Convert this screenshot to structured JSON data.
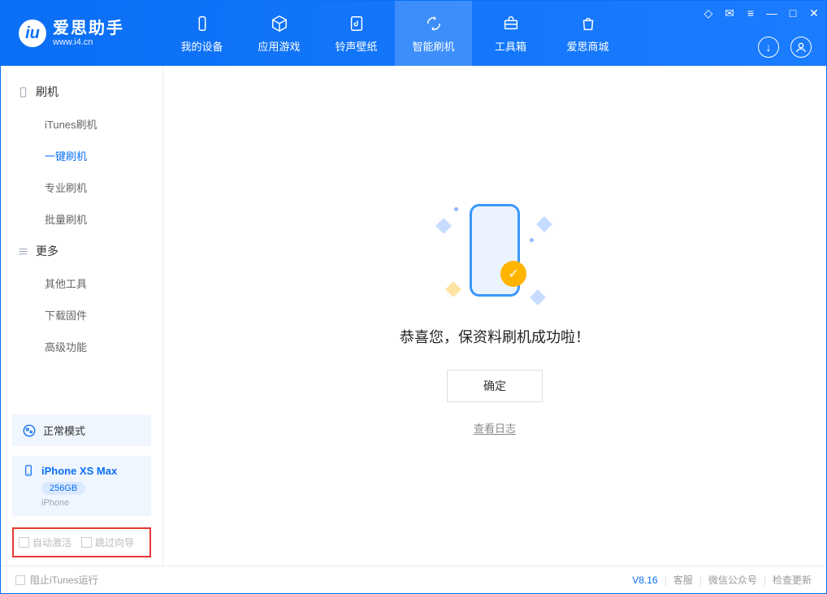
{
  "logo": {
    "main": "爱思助手",
    "sub": "www.i4.cn"
  },
  "tabs": {
    "t0": "我的设备",
    "t1": "应用游戏",
    "t2": "铃声壁纸",
    "t3": "智能刷机",
    "t4": "工具箱",
    "t5": "爱思商城"
  },
  "sidebar": {
    "sec1": "刷机",
    "items1": {
      "i0": "iTunes刷机",
      "i1": "一键刷机",
      "i2": "专业刷机",
      "i3": "批量刷机"
    },
    "sec2": "更多",
    "items2": {
      "i0": "其他工具",
      "i1": "下载固件",
      "i2": "高级功能"
    }
  },
  "mode": "正常模式",
  "device": {
    "name": "iPhone XS Max",
    "capacity": "256GB",
    "type": "iPhone"
  },
  "bottomChecks": {
    "c0": "自动激活",
    "c1": "跳过向导"
  },
  "main": {
    "success": "恭喜您，保资料刷机成功啦！",
    "ok": "确定",
    "log": "查看日志"
  },
  "footer": {
    "block": "阻止iTunes运行",
    "version": "V8.16",
    "l0": "客服",
    "l1": "微信公众号",
    "l2": "检查更新"
  }
}
